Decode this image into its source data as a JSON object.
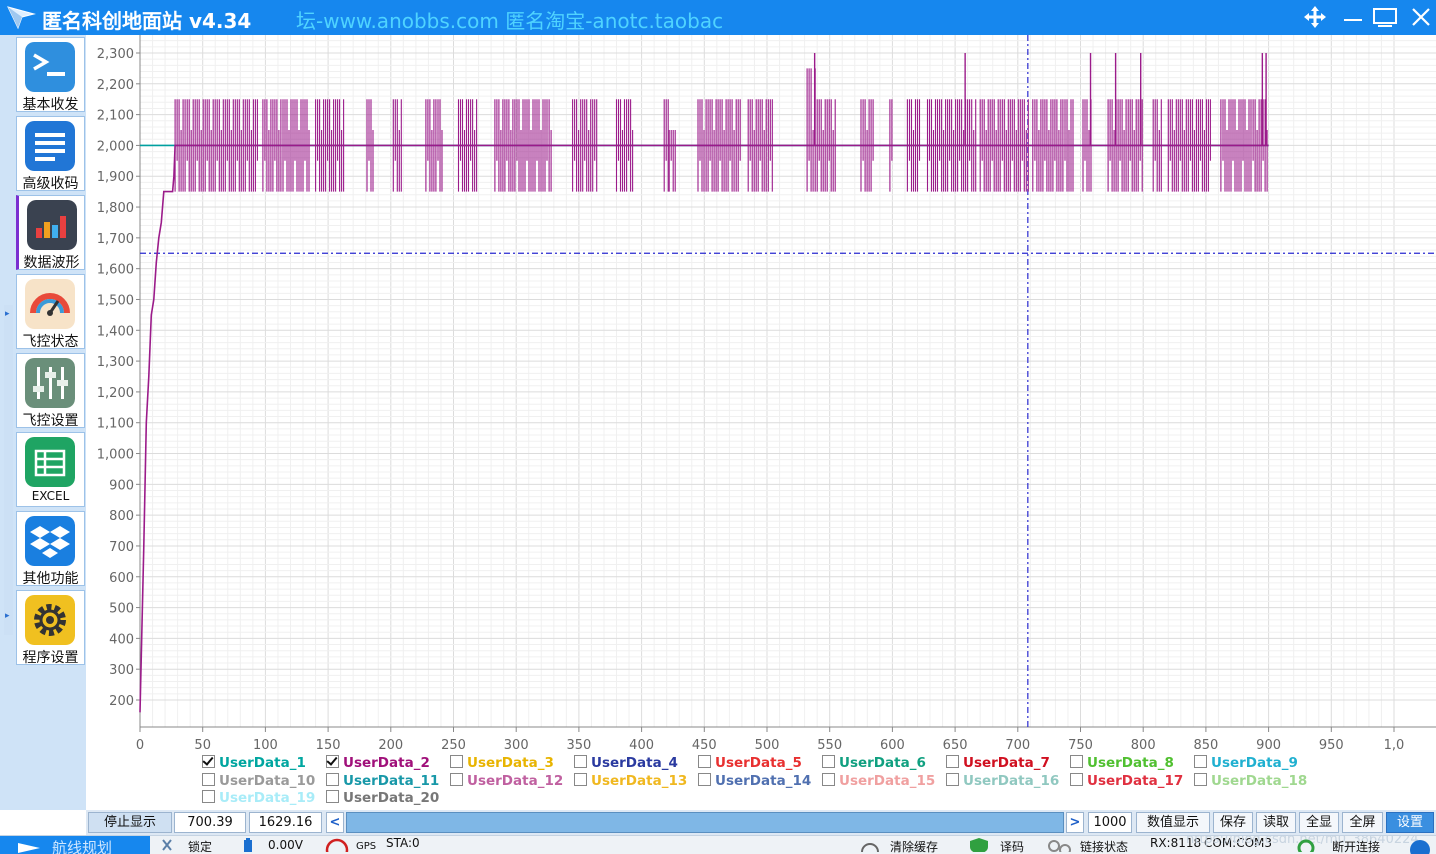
{
  "window": {
    "title": "匿名科创地面站 v4.34",
    "links": "坛-www.anobbs.com  匿名淘宝-anotc.taobac"
  },
  "sidebar": {
    "items": [
      {
        "label": "基本收发",
        "icon": "terminal-icon",
        "color": "#2f8fde"
      },
      {
        "label": "高级收码",
        "icon": "document-lines-icon",
        "color": "#2176d6"
      },
      {
        "label": "数据波形",
        "icon": "bar-chart-icon",
        "color": "#3a4250"
      },
      {
        "label": "飞控状态",
        "icon": "gauge-icon",
        "color": "#f3a44c"
      },
      {
        "label": "飞控设置",
        "icon": "sliders-icon",
        "color": "#6a8f7a"
      },
      {
        "label": "EXCEL",
        "icon": "spreadsheet-icon",
        "color": "#1fa463"
      },
      {
        "label": "其他功能",
        "icon": "dropbox-icon",
        "color": "#1a7fe0"
      },
      {
        "label": "程序设置",
        "icon": "gear-icon",
        "color": "#f0c020"
      }
    ],
    "active_index": 2
  },
  "chart_data": {
    "type": "line",
    "title": "",
    "xlabel": "",
    "ylabel": "",
    "xlim": [
      0,
      1000
    ],
    "ylim": [
      150,
      2350
    ],
    "x_ticks": [
      "0",
      "50",
      "100",
      "150",
      "200",
      "250",
      "300",
      "350",
      "400",
      "450",
      "500",
      "550",
      "600",
      "650",
      "700",
      "750",
      "800",
      "850",
      "900",
      "950",
      "1,0"
    ],
    "y_ticks": [
      "200",
      "300",
      "400",
      "500",
      "600",
      "700",
      "800",
      "900",
      "1,000",
      "1,100",
      "1,200",
      "1,300",
      "1,400",
      "1,500",
      "1,600",
      "1,700",
      "1,800",
      "1,900",
      "2,000",
      "2,100",
      "2,200",
      "2,300"
    ],
    "grid": true,
    "cursor": {
      "x": 708,
      "y": 1650
    },
    "series": [
      {
        "name": "UserData_1",
        "color": "#00a0a0",
        "points": [
          [
            0,
            2000
          ],
          [
            900,
            2000
          ]
        ]
      },
      {
        "name": "UserData_2",
        "color": "#9b1b8a",
        "points": [
          [
            0,
            160
          ],
          [
            3,
            700
          ],
          [
            5,
            1100
          ],
          [
            7,
            1250
          ],
          [
            9,
            1450
          ],
          [
            11,
            1500
          ],
          [
            13,
            1620
          ],
          [
            15,
            1700
          ],
          [
            17,
            1750
          ],
          [
            19,
            1850
          ],
          [
            22,
            1850
          ],
          [
            26,
            1850
          ],
          [
            27,
            1900
          ],
          [
            28,
            2000
          ],
          [
            900,
            2000
          ]
        ],
        "bands": [
          {
            "x": [
              28,
              95
            ],
            "min": 1850,
            "max": 2150
          },
          {
            "x": [
              98,
              135
            ],
            "min": 1850,
            "max": 2150
          },
          {
            "x": [
              140,
              163
            ],
            "min": 1850,
            "max": 2150
          },
          {
            "x": [
              181,
              187
            ],
            "min": 1850,
            "max": 2150
          },
          {
            "x": [
              202,
              209
            ],
            "min": 1850,
            "max": 2150
          },
          {
            "x": [
              228,
              242
            ],
            "min": 1850,
            "max": 2150
          },
          {
            "x": [
              254,
              270
            ],
            "min": 1850,
            "max": 2150
          },
          {
            "x": [
              283,
              328
            ],
            "min": 1850,
            "max": 2150
          },
          {
            "x": [
              345,
              365
            ],
            "min": 1850,
            "max": 2150
          },
          {
            "x": [
              380,
              393
            ],
            "min": 1850,
            "max": 2150
          },
          {
            "x": [
              418,
              422
            ],
            "min": 1850,
            "max": 2150
          },
          {
            "x": [
              422,
              428
            ],
            "min": 1850,
            "max": 2050
          },
          {
            "x": [
              445,
              480
            ],
            "min": 1850,
            "max": 2150
          },
          {
            "x": [
              485,
              505
            ],
            "min": 1850,
            "max": 2150
          },
          {
            "x": [
              532,
              540
            ],
            "min": 1850,
            "max": 2250
          },
          {
            "x": [
              540,
              555
            ],
            "min": 1850,
            "max": 2150
          },
          {
            "x": [
              575,
              585
            ],
            "min": 1850,
            "max": 2150
          },
          {
            "x": [
              598,
              600
            ],
            "min": 1850,
            "max": 2150
          },
          {
            "x": [
              612,
              622
            ],
            "min": 1850,
            "max": 2150
          },
          {
            "x": [
              628,
              668
            ],
            "min": 1850,
            "max": 2150
          },
          {
            "x": [
              670,
              710
            ],
            "min": 1850,
            "max": 2150
          },
          {
            "x": [
              712,
              745
            ],
            "min": 1850,
            "max": 2150
          },
          {
            "x": [
              752,
              760
            ],
            "min": 1850,
            "max": 2150
          },
          {
            "x": [
              772,
              800
            ],
            "min": 1850,
            "max": 2150
          },
          {
            "x": [
              808,
              815
            ],
            "min": 1850,
            "max": 2150
          },
          {
            "x": [
              820,
              855
            ],
            "min": 1850,
            "max": 2150
          },
          {
            "x": [
              862,
              900
            ],
            "min": 1850,
            "max": 2150
          }
        ],
        "spikes": [
          538,
          658,
          758,
          778,
          798,
          895,
          898
        ]
      }
    ]
  },
  "legend": [
    {
      "label": "UserData_1",
      "color": "#00a6a0",
      "checked": true
    },
    {
      "label": "UserData_2",
      "color": "#a0107a",
      "checked": true
    },
    {
      "label": "UserData_3",
      "color": "#e8b400",
      "checked": false
    },
    {
      "label": "UserData_4",
      "color": "#2a3aa0",
      "checked": false
    },
    {
      "label": "UserData_5",
      "color": "#e83030",
      "checked": false
    },
    {
      "label": "UserData_6",
      "color": "#10a080",
      "checked": false
    },
    {
      "label": "UserData_7",
      "color": "#d01020",
      "checked": false
    },
    {
      "label": "UserData_8",
      "color": "#50c030",
      "checked": false
    },
    {
      "label": "UserData_9",
      "color": "#20b0d0",
      "checked": false
    },
    {
      "label": "UserData_10",
      "color": "#9a9a9a",
      "checked": false
    },
    {
      "label": "UserData_11",
      "color": "#1898a8",
      "checked": false
    },
    {
      "label": "UserData_12",
      "color": "#c060a0",
      "checked": false
    },
    {
      "label": "UserData_13",
      "color": "#f0b820",
      "checked": false
    },
    {
      "label": "UserData_14",
      "color": "#5070b0",
      "checked": false
    },
    {
      "label": "UserData_15",
      "color": "#f0a0a0",
      "checked": false
    },
    {
      "label": "UserData_16",
      "color": "#90c8c0",
      "checked": false
    },
    {
      "label": "UserData_17",
      "color": "#e03040",
      "checked": false
    },
    {
      "label": "UserData_18",
      "color": "#a0d890",
      "checked": false
    },
    {
      "label": "UserData_19",
      "color": "#a8ecf8",
      "checked": false
    },
    {
      "label": "UserData_20",
      "color": "#777777",
      "checked": false
    }
  ],
  "controls": {
    "stop_display": "停止显示",
    "cursor_x": "700.39",
    "cursor_y": "1629.16",
    "scroll_left": "<",
    "scroll_right": ">",
    "points": "1000",
    "value_display": "数值显示",
    "save": "保存",
    "read": "读取",
    "show_all": "全显",
    "fullscreen": "全屏",
    "settings": "设置"
  },
  "status": {
    "route_plan": "航线规划",
    "lock": "锁定",
    "voltage": "0.00V",
    "gps": "GPS",
    "sta": "STA:0",
    "clear_cache": "清除缓存",
    "decode": "译码",
    "link_status": "链接状态",
    "rx": "RX:8118",
    "com": "COM:COM3",
    "disconnect": "断开连接",
    "watermark": "https://blog.csdn.net/m0_38640224"
  }
}
